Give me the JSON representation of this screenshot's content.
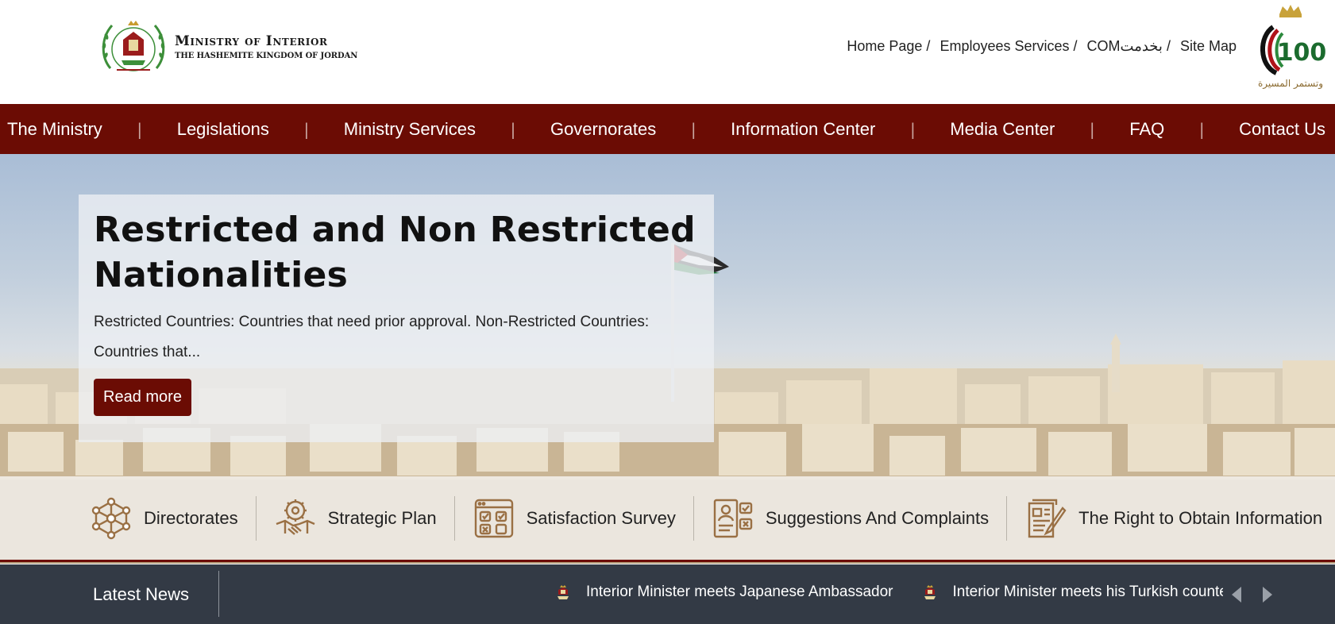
{
  "header": {
    "logo_title": "Ministry of Interior",
    "logo_subtitle": "THE HASHEMITE KINGDOM OF JORDAN",
    "top_links": [
      {
        "label": "Home Page"
      },
      {
        "label": "Employees Services"
      },
      {
        "label": "COMبخدمت"
      },
      {
        "label": "Site Map"
      }
    ],
    "separator": "/",
    "centenary_number": "100",
    "centenary_caption": "وتستمر المسيرة"
  },
  "nav": {
    "items": [
      {
        "label": "The Ministry"
      },
      {
        "label": "Legislations"
      },
      {
        "label": "Ministry Services"
      },
      {
        "label": "Governorates"
      },
      {
        "label": "Information Center"
      },
      {
        "label": "Media Center"
      },
      {
        "label": "FAQ"
      },
      {
        "label": "Contact Us"
      }
    ],
    "separator": "|"
  },
  "hero": {
    "title": "Restricted and Non Restricted Nationalities",
    "description": "Restricted Countries: Countries that need prior approval. Non-Restricted Countries: Countries that...",
    "button_label": "Read more"
  },
  "quick_links": [
    {
      "label": "Directorates",
      "icon": "network-icon"
    },
    {
      "label": "Strategic Plan",
      "icon": "handshake-gear-icon"
    },
    {
      "label": "Satisfaction Survey",
      "icon": "survey-checklist-icon"
    },
    {
      "label": "Suggestions And Complaints",
      "icon": "complaint-form-icon"
    },
    {
      "label": "The Right to Obtain Information",
      "icon": "document-pen-icon"
    }
  ],
  "news": {
    "label": "Latest News",
    "items": [
      {
        "text": "Interior Minister meets Japanese Ambassador"
      },
      {
        "text": "Interior Minister meets his Turkish counterpart"
      }
    ]
  },
  "colors": {
    "brand": "#6b0c04",
    "news_bar": "#333a45",
    "icon_gold": "#9a7044"
  }
}
